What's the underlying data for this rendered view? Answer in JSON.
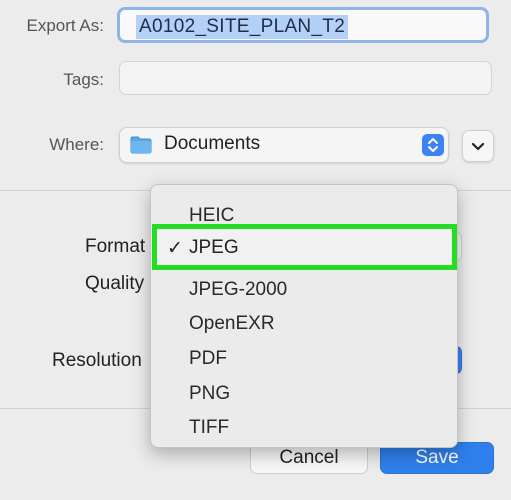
{
  "dialog": {
    "export_as_label": "Export As:",
    "export_as_value": "A0102_SITE_PLAN_T2",
    "tags_label": "Tags:",
    "tags_value": "",
    "where_label": "Where:",
    "where_value": "Documents",
    "format_label": "Format",
    "quality_label": "Quality",
    "resolution_label": "Resolution",
    "cancel_label": "Cancel",
    "save_label": "Save"
  },
  "format_menu": {
    "selected": "JPEG",
    "items": [
      "HEIC",
      "JPEG",
      "JPEG-2000",
      "OpenEXR",
      "PDF",
      "PNG",
      "TIFF"
    ],
    "check_glyph": "✓"
  },
  "colors": {
    "accent": "#2f80ed",
    "highlight_border": "#22dd22",
    "selection": "#b3d1f6"
  },
  "icons": [
    "folder-icon",
    "up-down-chevron-icon",
    "chevron-down-icon",
    "checkmark-icon"
  ]
}
